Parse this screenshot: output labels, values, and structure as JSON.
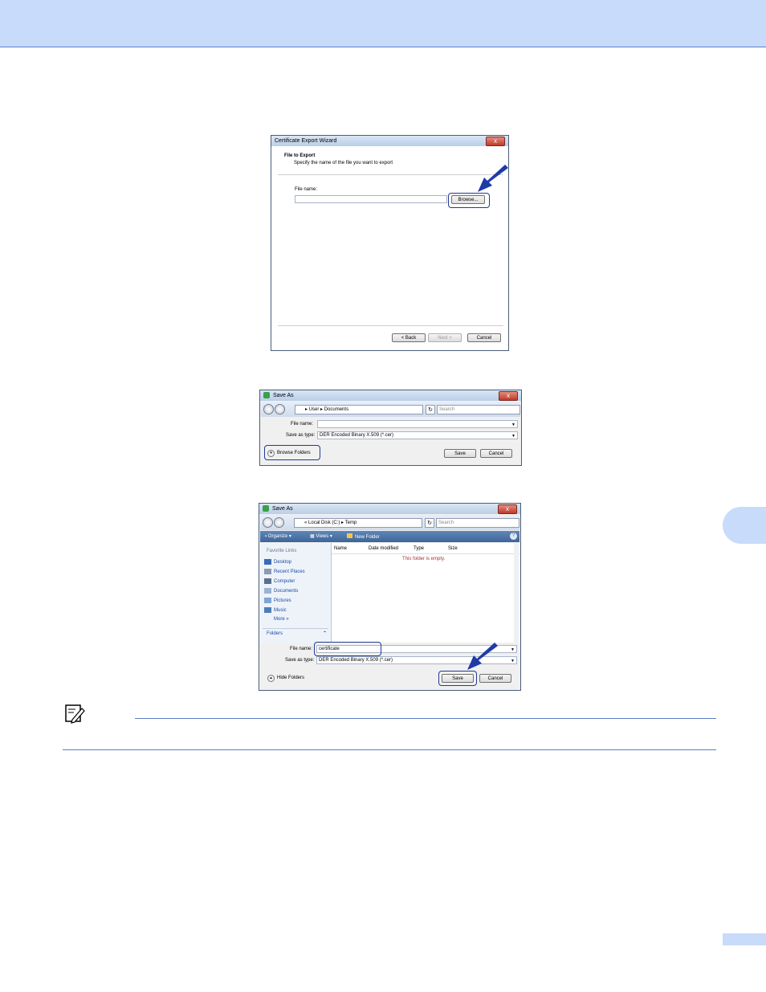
{
  "wizard": {
    "title": "Certificate Export Wizard",
    "close_glyph": "x",
    "section_title": "File to Export",
    "section_desc": "Specify the name of the file you want to export",
    "file_name_label": "File name:",
    "file_name_value": "",
    "browse_label": "Browse...",
    "back_label": "< Back",
    "next_label": "Next >",
    "cancel_label": "Cancel"
  },
  "saveas1": {
    "title": "Save As",
    "close_glyph": "x",
    "crumbs": [
      "User",
      "Documents"
    ],
    "search_placeholder": "Search",
    "file_name_label": "File name:",
    "file_name_value": "",
    "save_type_label": "Save as type:",
    "save_type_value": "DER Encoded Binary X.509 (*.cer)",
    "browse_folders_label": "Browse Folders",
    "save_label": "Save",
    "cancel_label": "Cancel"
  },
  "saveas2": {
    "title": "Save As",
    "close_glyph": "x",
    "address_prefix": "«",
    "crumbs": [
      "Local Disk (C:)",
      "Temp"
    ],
    "search_placeholder": "Search",
    "toolbar": {
      "organize": "Organize",
      "views": "Views",
      "new_folder": "New Folder"
    },
    "favorite_links_heading": "Favorite Links",
    "links": [
      "Desktop",
      "Recent Places",
      "Computer",
      "Documents",
      "Pictures",
      "Music"
    ],
    "more_label": "More",
    "more_glyph": "»",
    "folders_label": "Folders",
    "columns": [
      "Name",
      "Date modified",
      "Type",
      "Size"
    ],
    "empty_message": "This folder is empty.",
    "file_name_label": "File name:",
    "file_name_value": "certificate",
    "save_type_label": "Save as type:",
    "save_type_value": "DER Encoded Binary X.509 (*.cer)",
    "hide_folders_label": "Hide Folders",
    "save_label": "Save",
    "cancel_label": "Cancel"
  },
  "colors": {
    "accent": "#c9dbfb",
    "rule": "#5b7fc7",
    "highlight": "#1f3a93",
    "arrow": "#1f3aa8"
  }
}
